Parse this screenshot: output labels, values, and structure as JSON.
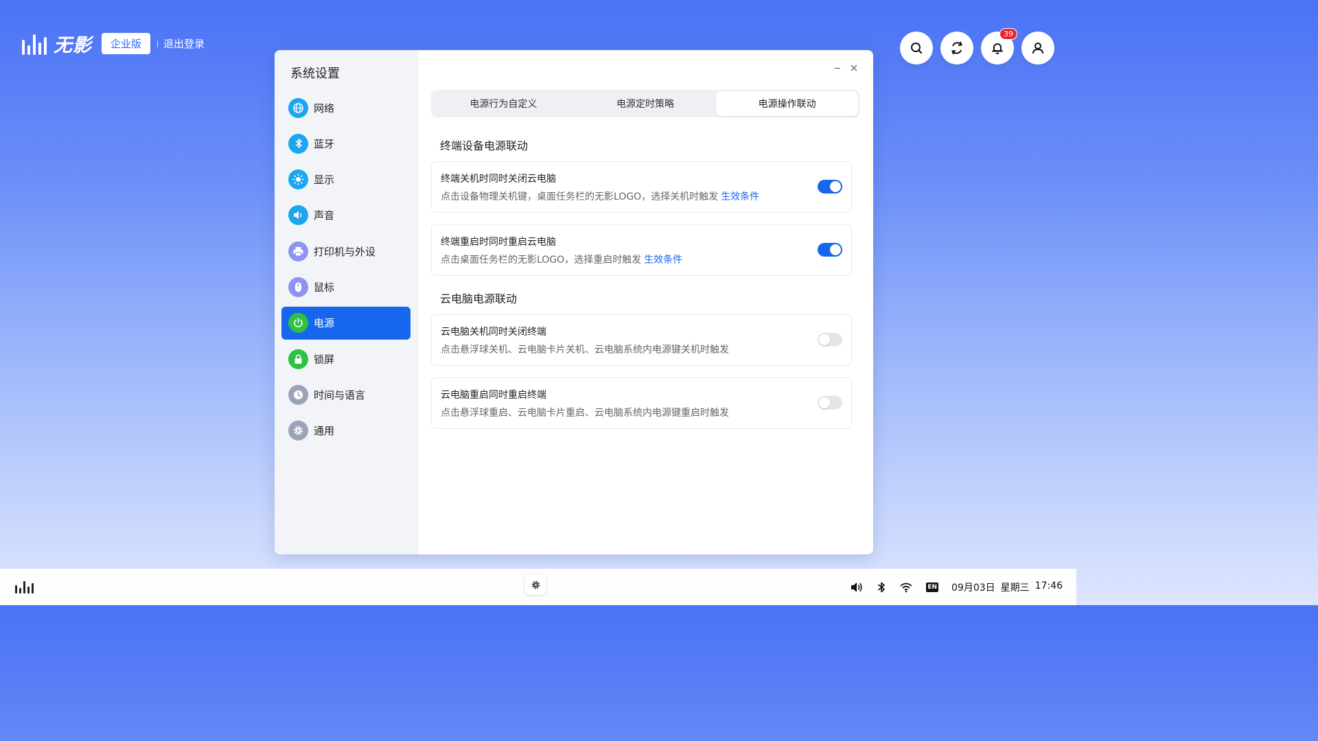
{
  "brand": {
    "name": "无影",
    "edition": "企业版",
    "logout": "退出登录"
  },
  "top_actions": {
    "notifications_count": "39"
  },
  "window": {
    "title": "系统设置",
    "sidebar": [
      {
        "label": "网络",
        "icon": "globe-icon",
        "color": "#1aa6f0"
      },
      {
        "label": "蓝牙",
        "icon": "bluetooth-icon",
        "color": "#1aa6f0"
      },
      {
        "label": "显示",
        "icon": "brightness-icon",
        "color": "#1aa6f0"
      },
      {
        "label": "声音",
        "icon": "speaker-icon",
        "color": "#1aa6f0"
      },
      {
        "label": "打印机与外设",
        "icon": "printer-icon",
        "color": "#8c94f0"
      },
      {
        "label": "鼠标",
        "icon": "mouse-icon",
        "color": "#8c94f0"
      },
      {
        "label": "电源",
        "icon": "power-icon",
        "color": "#2fc142",
        "active": true
      },
      {
        "label": "锁屏",
        "icon": "lock-icon",
        "color": "#2fc142"
      },
      {
        "label": "时间与语言",
        "icon": "clock-icon",
        "color": "#9aa3b8"
      },
      {
        "label": "通用",
        "icon": "gear-icon",
        "color": "#9aa3b8"
      }
    ],
    "tabs": [
      "电源行为自定义",
      "电源定时策略",
      "电源操作联动"
    ],
    "active_tab": 2,
    "sections": [
      {
        "title": "终端设备电源联动",
        "items": [
          {
            "title": "终端关机时同时关闭云电脑",
            "desc": "点击设备物理关机键，桌面任务栏的无影LOGO，选择关机时触发",
            "link": "生效条件",
            "on": true
          },
          {
            "title": "终端重启时同时重启云电脑",
            "desc": "点击桌面任务栏的无影LOGO，选择重启时触发",
            "link": "生效条件",
            "on": true
          }
        ]
      },
      {
        "title": "云电脑电源联动",
        "items": [
          {
            "title": "云电脑关机同时关闭终端",
            "desc": "点击悬浮球关机、云电脑卡片关机、云电脑系统内电源键关机时触发",
            "on": false
          },
          {
            "title": "云电脑重启同时重启终端",
            "desc": "点击悬浮球重启、云电脑卡片重启、云电脑系统内电源键重启时触发",
            "on": false
          }
        ]
      }
    ]
  },
  "taskbar": {
    "input_method": "EN",
    "date": "09月03日",
    "weekday": "星期三",
    "time": "17:46"
  },
  "colors": {
    "accent": "#1767ee",
    "toggle_off": "#e4e6ea"
  }
}
